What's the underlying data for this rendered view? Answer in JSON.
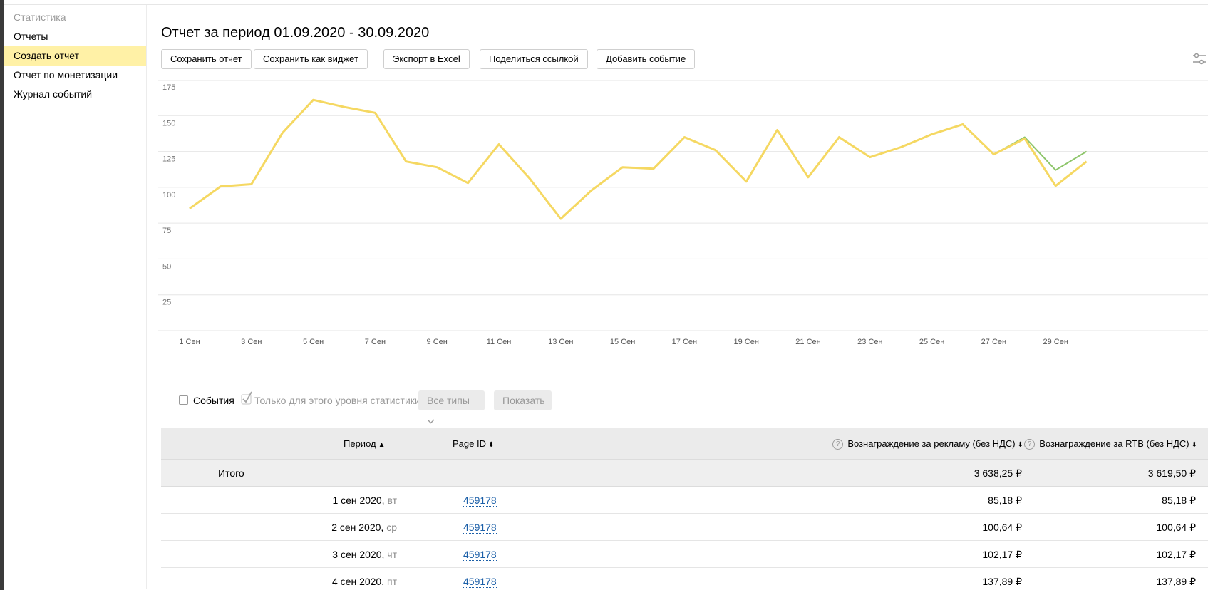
{
  "sidebar": {
    "title": "Статистика",
    "items": [
      {
        "label": "Отчеты",
        "active": false
      },
      {
        "label": "Создать отчет",
        "active": true
      },
      {
        "label": "Отчет по монетизации",
        "active": false
      },
      {
        "label": "Журнал событий",
        "active": false
      }
    ]
  },
  "page": {
    "title": "Отчет за период 01.09.2020 - 30.09.2020"
  },
  "toolbar": {
    "buttons": [
      "Сохранить отчет",
      "Сохранить как виджет",
      "Экспорт в Excel",
      "Поделиться ссылкой",
      "Добавить событие"
    ],
    "settings_icon": "sliders-icon"
  },
  "chart_data": {
    "type": "line",
    "title": "",
    "xlabel": "",
    "ylabel": "",
    "ylim": [
      0,
      175
    ],
    "yticks": [
      25,
      50,
      75,
      100,
      125,
      150,
      175
    ],
    "grid": true,
    "x": [
      1,
      2,
      3,
      4,
      5,
      6,
      7,
      8,
      9,
      10,
      11,
      12,
      13,
      14,
      15,
      16,
      17,
      18,
      19,
      20,
      21,
      22,
      23,
      24,
      25,
      26,
      27,
      28,
      29,
      30
    ],
    "xtick_labels": [
      "1 Сен",
      "3 Сен",
      "5 Сен",
      "7 Сен",
      "9 Сен",
      "11 Сен",
      "13 Сен",
      "15 Сен",
      "17 Сен",
      "19 Сен",
      "21 Сен",
      "23 Сен",
      "25 Сен",
      "27 Сен",
      "29 Сен"
    ],
    "series": [
      {
        "color": "#f5d862",
        "values": [
          85.18,
          100.64,
          102.17,
          137.89,
          161,
          156,
          152,
          118,
          114,
          103,
          130,
          106,
          78,
          98,
          114,
          113,
          135,
          126,
          104,
          140,
          107,
          135,
          121,
          128,
          137,
          144,
          123,
          134,
          101,
          118
        ]
      },
      {
        "color": "#8dc56a",
        "values": [
          85.18,
          100.64,
          102.17,
          137.89,
          161,
          156,
          152,
          118,
          114,
          103,
          130,
          106,
          78,
          98,
          114,
          113,
          135,
          126,
          104,
          140,
          107,
          135,
          121,
          128,
          137,
          144,
          123,
          135,
          112,
          125
        ]
      }
    ]
  },
  "controls": {
    "events_label": "События",
    "level_only_label": "Только для этого уровня статистики",
    "types_label": "Все типы",
    "show_label": "Показать"
  },
  "table": {
    "headers": {
      "period": "Период",
      "page_id": "Page ID",
      "ad_reward": "Вознаграждение за рекламу (без НДС)",
      "rtb_reward": "Вознаграждение за RTB (без НДС)"
    },
    "total": {
      "label": "Итого",
      "ad": "3 638,25 ₽",
      "rtb": "3 619,50 ₽"
    },
    "rows": [
      {
        "date": "1 сен 2020",
        "weekday": "вт",
        "page_id": "459178",
        "ad": "85,18 ₽",
        "rtb": "85,18 ₽"
      },
      {
        "date": "2 сен 2020",
        "weekday": "ср",
        "page_id": "459178",
        "ad": "100,64 ₽",
        "rtb": "100,64 ₽"
      },
      {
        "date": "3 сен 2020",
        "weekday": "чт",
        "page_id": "459178",
        "ad": "102,17 ₽",
        "rtb": "102,17 ₽"
      },
      {
        "date": "4 сен 2020",
        "weekday": "пт",
        "page_id": "459178",
        "ad": "137,89 ₽",
        "rtb": "137,89 ₽"
      }
    ]
  }
}
